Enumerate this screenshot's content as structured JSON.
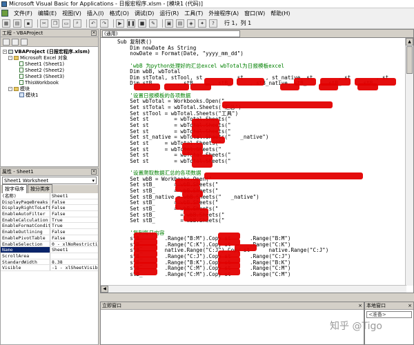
{
  "window": {
    "title": "Microsoft Visual Basic for Applications - 日报宏程序.xlsm - [模块1 (代码)]"
  },
  "menu": [
    "文件(F)",
    "编辑(E)",
    "视图(V)",
    "插入(I)",
    "格式(O)",
    "调试(D)",
    "运行(R)",
    "工具(T)",
    "外接程序(A)",
    "窗口(W)",
    "帮助(H)"
  ],
  "toolbar": {
    "cursor_position": "行 1，列 1"
  },
  "project": {
    "header": "工程 - VBAProject",
    "tree": [
      {
        "label": "VBAProject (日报宏程序.xlsm)",
        "kind": "project",
        "expanded": "-"
      },
      {
        "label": "Microsoft Excel 对象",
        "kind": "folder",
        "expanded": "-"
      },
      {
        "label": "Sheet1 (Sheet1)",
        "kind": "sheet"
      },
      {
        "label": "Sheet2 (Sheet2)",
        "kind": "sheet"
      },
      {
        "label": "Sheet3 (Sheet3)",
        "kind": "sheet"
      },
      {
        "label": "ThisWorkbook",
        "kind": "sheet"
      },
      {
        "label": "模块",
        "kind": "folder",
        "expanded": "-"
      },
      {
        "label": "模块1",
        "kind": "module"
      }
    ]
  },
  "properties": {
    "header": "属性 - Sheet1",
    "object": "Sheet1 Worksheet",
    "tabs": [
      "按字母序",
      "按分类序"
    ],
    "rows": [
      [
        "(名称)",
        "Sheet1"
      ],
      [
        "DisplayPageBreaks",
        "False"
      ],
      [
        "DisplayRightToLeft",
        "False"
      ],
      [
        "EnableAutoFilter",
        "False"
      ],
      [
        "EnableCalculation",
        "True"
      ],
      [
        "EnableFormatConditions",
        "True"
      ],
      [
        "EnableOutlining",
        "False"
      ],
      [
        "EnablePivotTable",
        "False"
      ],
      [
        "EnableSelection",
        "0 - xlNoRestrictions"
      ],
      [
        "Name",
        "Sheet1"
      ],
      [
        "ScrollArea",
        ""
      ],
      [
        "StandardWidth",
        "8.38"
      ],
      [
        "Visible",
        "-1 - xlSheetVisible"
      ]
    ],
    "selected_row": "Name"
  },
  "code": {
    "procedure": "(通用)",
    "lines": [
      "Sub 复制表()",
      "    Dim nowDate As String",
      "    nowDate = Format(Date, \"yyyy_mm_dd\")",
      "",
      "    'wbB 为python处理好的汇总excel wbTotal为日报模板excel",
      "    Dim wbB, wbTotal",
      "    Dim stTotal, stTool, st         , st       , st_native, st        , st        , st",
      "    Dim stB_       , stB_     , stB_      , stB_native, stB_     , stB_     , stB_",
      "",
      "    '设置日报模板的各项数据",
      "    Set wbTotal = Workbooks.Open(\"",
      "    Set stTotal = wbTotal.Sheets(\"汇总\")",
      "    Set stTool = wbTotal.Sheets(\"工具\")",
      "    Set st        = wbTotal.Sheets(\"",
      "    Set st        = wbTotal.Sheets(\"",
      "    Set st        = wbTotal.Sheets(\"",
      "    Set st_native = wbTotal.Sheets(\"   _native\")",
      "    Set st     = wbTotal.Sheets(\"",
      "    Set st     = wbTotal.Sheets(\"",
      "    Set st        = wbTotal.Sheets(\"",
      "    Set st        = wbTotal.Sheets(\"",
      "",
      "    '设置爬取数据汇总的各项数据",
      "    Set wbB = Workbooks.Open(\"",
      "    Set stB_      = wbB.Sheets(\"",
      "    Set stB_      = wbB.Sheets(\"",
      "    Set stB_native = wbB.Sheets(\"   _native\")",
      "    Set stB_      = wbB.Sheets(\"",
      "    Set stB_      = wbB.Sheets(\"",
      "    Set stB_        = wbB.Sheets(\"",
      "    Set stB_        = wbB.Sheets(\"",
      "",
      "    '复制每日内容",
      "    stB_       .Range(\"B:M\").Copy st      .Range(\"B:M\")",
      "    stB_       .Range(\"C:K\").Copy st      .Range(\"C:K\")",
      "    stB_       native.Range(\"C:J\").Copy st      native.Range(\"C:J\")",
      "    stB_       .Range(\"C:J\").Copy st      .Range(\"C:J\")",
      "    stB_       .Range(\"B:K\").Copy st      .Range(\"B:K\")",
      "    stB_       .Range(\"C:M\").Copy st      .Range(\"C:M\")",
      "    stB_       .Range(\"C:M\").Copy st      .Range(\"C:M\")"
    ]
  },
  "immediate": {
    "header": "立即窗口"
  },
  "locals": {
    "header": "本地窗口",
    "field": "<准备>"
  },
  "watermark": "知乎 @Tigo",
  "colors": {
    "comment": "#008000",
    "redaction": "#e30000",
    "selection": "#0a246a"
  }
}
